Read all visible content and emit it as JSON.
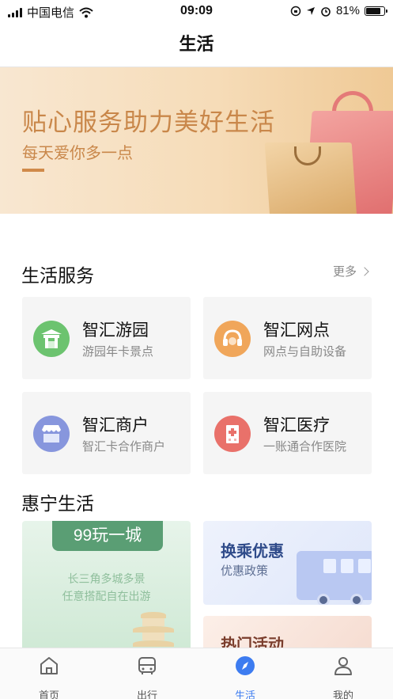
{
  "status_bar": {
    "carrier": "中国电信",
    "time": "09:09",
    "battery_percent": "81%",
    "battery_level": 0.81,
    "icons": [
      "signal-icon",
      "wifi-icon",
      "lock-rotation-icon",
      "location-icon",
      "alarm-icon",
      "battery-icon"
    ]
  },
  "nav": {
    "title": "生活"
  },
  "banner": {
    "title": "贴心服务助力美好生活",
    "subtitle": "每天爱你多一点",
    "colors": {
      "text": "#c9874a",
      "bg": "#f6dcb8"
    }
  },
  "life_services": {
    "title": "生活服务",
    "more_label": "更多",
    "items": [
      {
        "title": "智汇游园",
        "subtitle": "游园年卡景点",
        "icon": "garden-gate-icon",
        "color": "#6cc36f"
      },
      {
        "title": "智汇网点",
        "subtitle": "网点与自助设备",
        "icon": "headset-icon",
        "color": "#f0a65a"
      },
      {
        "title": "智汇商户",
        "subtitle": "智汇卡合作商户",
        "icon": "storefront-icon",
        "color": "#8796dd"
      },
      {
        "title": "智汇医疗",
        "subtitle": "一账通合作医院",
        "icon": "hospital-icon",
        "color": "#e9716a"
      }
    ]
  },
  "huining": {
    "title": "惠宁生活",
    "promo_main": {
      "tag": "99玩一城",
      "line1": "长三角多城多景",
      "line2": "任意搭配自在出游"
    },
    "promo_transfer": {
      "title": "换乘优惠",
      "subtitle": "优惠政策"
    },
    "promo_events": {
      "title": "热门活动"
    }
  },
  "tab_bar": {
    "items": [
      {
        "label": "首页",
        "icon": "home-icon"
      },
      {
        "label": "出行",
        "icon": "bus-icon"
      },
      {
        "label": "生活",
        "icon": "compass-icon"
      },
      {
        "label": "我的",
        "icon": "person-icon"
      }
    ],
    "active_color": "#3d7cf0"
  }
}
